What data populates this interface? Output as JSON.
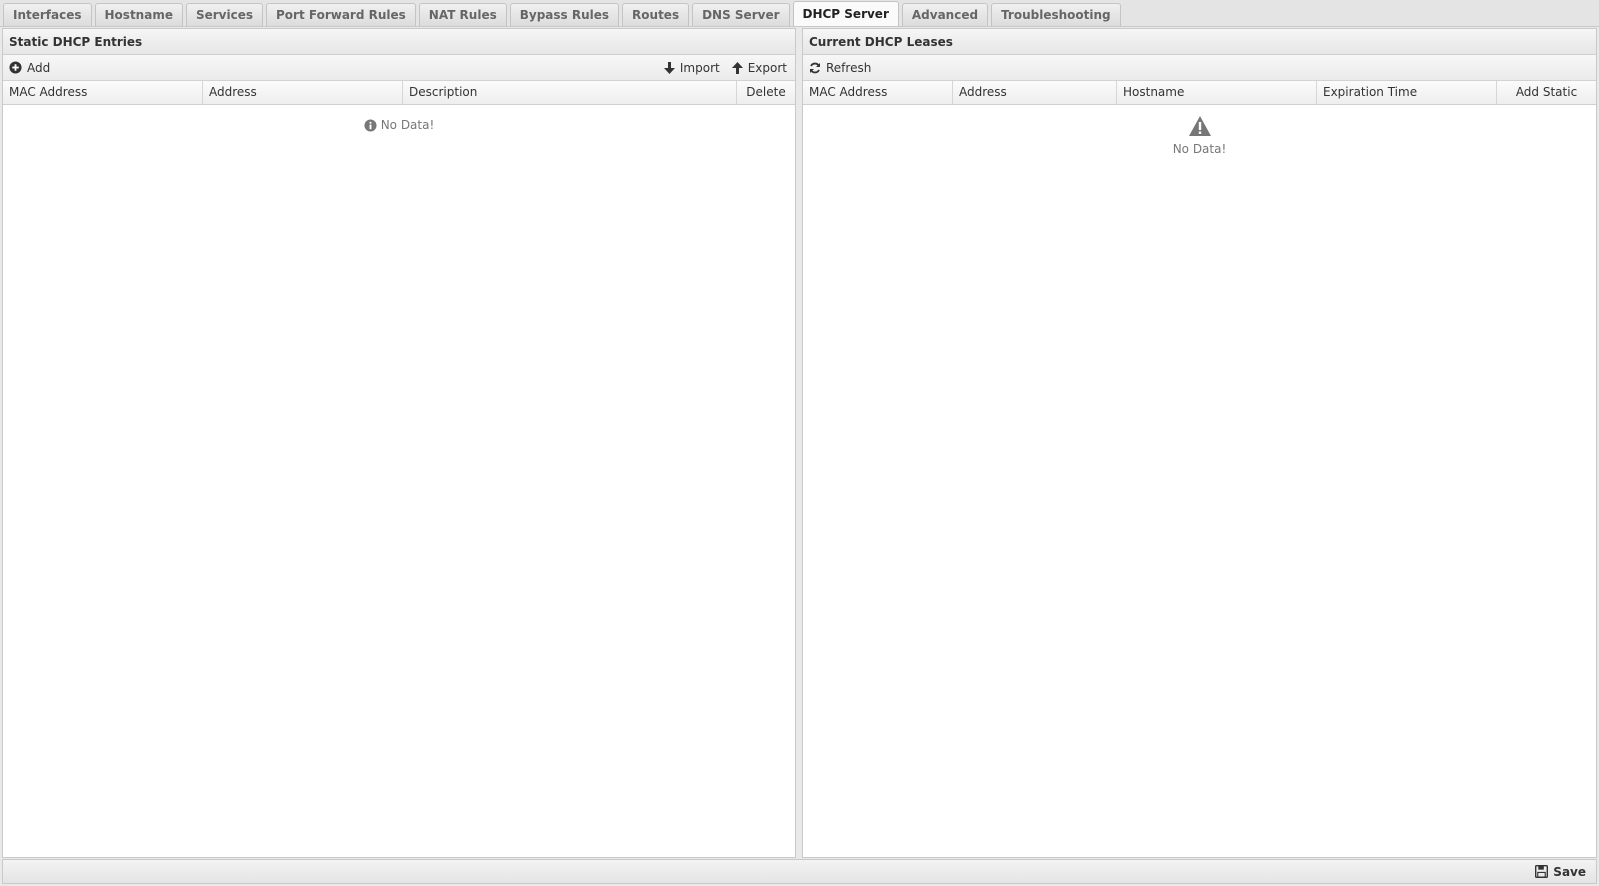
{
  "tabs": [
    {
      "label": "Interfaces"
    },
    {
      "label": "Hostname"
    },
    {
      "label": "Services"
    },
    {
      "label": "Port Forward Rules"
    },
    {
      "label": "NAT Rules"
    },
    {
      "label": "Bypass Rules"
    },
    {
      "label": "Routes"
    },
    {
      "label": "DNS Server"
    },
    {
      "label": "DHCP Server",
      "active": true
    },
    {
      "label": "Advanced"
    },
    {
      "label": "Troubleshooting"
    }
  ],
  "static_panel": {
    "title": "Static DHCP Entries",
    "add_label": "Add",
    "import_label": "Import",
    "export_label": "Export",
    "columns": [
      "MAC Address",
      "Address",
      "Description",
      "Delete"
    ],
    "empty_text": "No Data!"
  },
  "leases_panel": {
    "title": "Current DHCP Leases",
    "refresh_label": "Refresh",
    "columns": [
      "MAC Address",
      "Address",
      "Hostname",
      "Expiration Time",
      "Add Static"
    ],
    "empty_text": "No Data!"
  },
  "footer": {
    "save_label": "Save"
  },
  "icons": {
    "add": "plus-circle-icon",
    "import": "arrow-down-icon",
    "export": "arrow-up-icon",
    "refresh": "refresh-icon",
    "info": "info-circle-icon",
    "warning": "warning-triangle-icon",
    "save": "floppy-disk-icon"
  }
}
